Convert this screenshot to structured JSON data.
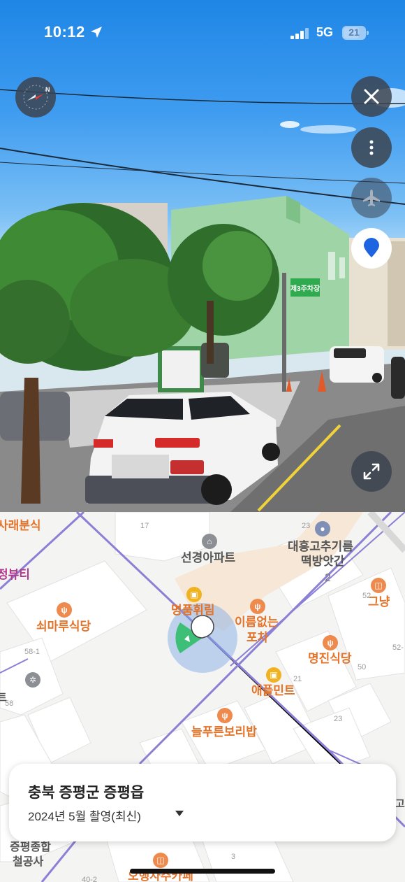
{
  "status_bar": {
    "time": "10:12",
    "network": "5G",
    "battery": "21"
  },
  "street_view": {
    "icons": [
      "compass-icon",
      "close-icon",
      "more-icon",
      "airplane-icon",
      "location-pin-icon",
      "expand-icon"
    ],
    "sign_text": "제3주차장"
  },
  "map": {
    "pois": {
      "p1": "사래분식",
      "p2": "정뷰티",
      "p3": "쇠마루식당",
      "p4": "선경아파트",
      "p5_line1": "대흥고추기름",
      "p5_line2": "떡방앗간",
      "p6": "명품휘림",
      "p7_line1": "이름없는",
      "p7_line2": "포차",
      "p8": "그냥",
      "p9": "명진식당",
      "p10": "애플민트",
      "p11": "늘푸른보리밥",
      "p12_line1": "증평종합",
      "p12_line2": "철공사",
      "p13": "오행사주카페",
      "p14": "고",
      "p15": "트"
    },
    "lots": {
      "l1": "17",
      "l2": "23",
      "l3": "52",
      "l4": "58-1",
      "l5": "58",
      "l6": "21",
      "l7": "50",
      "l8": "52-",
      "l9": "23",
      "l10": "3",
      "l11": "40-2",
      "l12": "2"
    }
  },
  "info_card": {
    "region": "충북 증평군 증평읍",
    "date": "2024년 5월 촬영(최신)"
  },
  "colors": {
    "road_line": "#8b7fd6",
    "poi_orange": "#e3742a",
    "view_cone": "#2fbd6a",
    "view_circle": "#7aa7e6"
  }
}
